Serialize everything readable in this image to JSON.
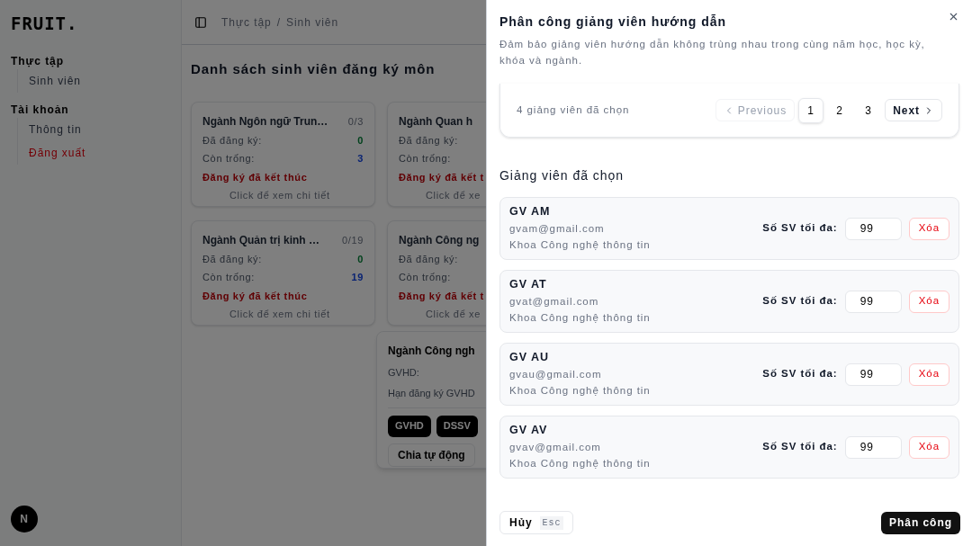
{
  "sidebar": {
    "logo": "FRUIT.",
    "groups": [
      {
        "label": "Thực tập",
        "items": [
          {
            "label": "Sinh viên",
            "kind": "link"
          }
        ]
      },
      {
        "label": "Tài khoản",
        "items": [
          {
            "label": "Thông tin",
            "kind": "link"
          },
          {
            "label": "Đăng xuất",
            "kind": "danger"
          }
        ]
      }
    ],
    "dev_badge": "N"
  },
  "breadcrumb": {
    "items": [
      "Thực tập",
      "Sinh viên"
    ],
    "separator": "/"
  },
  "page_title": "Danh sách sinh viên đăng ký môn",
  "cards": [
    {
      "title": "Ngành Ngôn ngữ Trun…",
      "count": "0/3",
      "registered_label": "Đã đăng ký:",
      "registered": "0",
      "available_label": "Còn trống:",
      "available": "3",
      "status": "Đăng ký đã kết thúc",
      "hint": "Click để xem chi tiết"
    },
    {
      "title": "Ngành Quan h",
      "registered_label": "Đã đăng ký:",
      "available_label": "Còn trống:",
      "status": "Đăng ký đã kết t",
      "hint": "Click để xe"
    },
    {
      "title": "Ngành Quản trị kinh …",
      "count": "0/19",
      "registered_label": "Đã đăng ký:",
      "registered": "0",
      "available_label": "Còn trống:",
      "available": "19",
      "status": "Đăng ký đã kết thúc",
      "hint": "Click để xem chi tiết"
    },
    {
      "title": "Ngành Công ng",
      "registered_label": "Đã đăng ký:",
      "available_label": "Còn trống:",
      "status": "Đăng ký đã kết t",
      "hint": "Click để xe"
    }
  ],
  "detail_card": {
    "title": "Ngành Công ngh",
    "lines": [
      "GVHD:",
      "Hạn đăng ký GVHD"
    ],
    "buttons": [
      "GVHD",
      "DSSV"
    ],
    "secondary_button": "Chia tự động"
  },
  "dialog": {
    "title": "Phân công giảng viên hướng dẫn",
    "description": "Đảm bảo giảng viên hướng dẫn không trùng nhau trong cùng năm học, học kỳ, khóa và ngành.",
    "selection_count": "4 giảng viên đã chọn",
    "pagination": {
      "previous": {
        "label": "Previous",
        "disabled": true
      },
      "pages": [
        {
          "label": "1",
          "selected": true
        },
        {
          "label": "2",
          "selected": false
        },
        {
          "label": "3",
          "selected": false
        }
      ],
      "next": {
        "label": "Next",
        "disabled": false
      }
    },
    "selected_heading": "Giảng viên đã chọn",
    "lecturers": [
      {
        "name": "GV AM",
        "email": "gvam@gmail.com",
        "faculty": "Khoa Công nghệ thông tin",
        "max_label": "Số SV tối đa:",
        "max": "99",
        "remove": "Xóa"
      },
      {
        "name": "GV AT",
        "email": "gvat@gmail.com",
        "faculty": "Khoa Công nghệ thông tin",
        "max_label": "Số SV tối đa:",
        "max": "99",
        "remove": "Xóa"
      },
      {
        "name": "GV AU",
        "email": "gvau@gmail.com",
        "faculty": "Khoa Công nghệ thông tin",
        "max_label": "Số SV tối đa:",
        "max": "99",
        "remove": "Xóa"
      },
      {
        "name": "GV AV",
        "email": "gvav@gmail.com",
        "faculty": "Khoa Công nghệ thông tin",
        "max_label": "Số SV tối đa:",
        "max": "99",
        "remove": "Xóa"
      }
    ],
    "cancel": {
      "label": "Hủy",
      "shortcut": "Esc"
    },
    "submit": "Phân công"
  }
}
